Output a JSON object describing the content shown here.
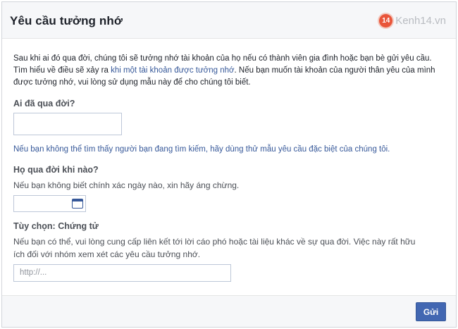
{
  "dialog": {
    "title": "Yêu cầu tưởng nhớ"
  },
  "watermark": {
    "badge": "14",
    "text": "Kenh14.vn"
  },
  "intro": {
    "before_link": "Sau khi ai đó qua đời, chúng tôi sẽ tưởng nhớ tài khoản của họ nếu có thành viên gia đình hoặc bạn bè gửi yêu cầu. Tìm hiểu về điều sẽ xảy ra ",
    "link": "khi một tài khoản được tưởng nhớ",
    "after_link": ". Nếu bạn muốn tài khoản của người thân yêu của mình được tưởng nhớ, vui lòng sử dụng mẫu này để cho chúng tôi biết."
  },
  "who": {
    "label": "Ai đã qua đời?",
    "value": "",
    "alt_link": "Nếu bạn không thể tìm thấy người bạn đang tìm kiếm, hãy dùng thử mẫu yêu cầu đặc biệt của chúng tôi."
  },
  "when": {
    "label": "Họ qua đời khi nào?",
    "hint": "Nếu bạn không biết chính xác ngày nào, xin hãy áng chừng.",
    "value": ""
  },
  "proof": {
    "label": "Tùy chọn: Chứng tử",
    "hint_line1": "Nếu bạn có thể, vui lòng cung cấp liên kết tới lời cáo phó hoặc tài liệu khác về sự qua đời. Việc này rất hữu",
    "hint_line2": "ích đối với nhóm xem xét các yêu cầu tưởng nhớ.",
    "placeholder": "http://..."
  },
  "footer": {
    "submit_label": "Gửi"
  }
}
